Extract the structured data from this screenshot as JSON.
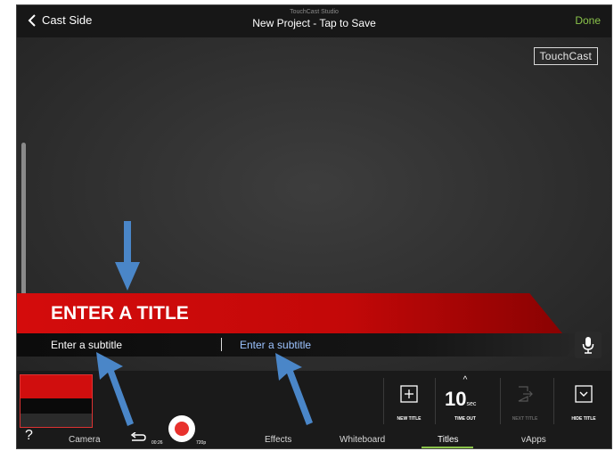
{
  "topbar": {
    "back_label": "Cast Side",
    "studio_label": "TouchCast Studio",
    "project_title": "New Project - Tap to Save",
    "done_label": "Done"
  },
  "stage": {
    "logo_text": "TouchCast",
    "title_text": "ENTER A TITLE",
    "subtitle_left": "Enter a subtitle",
    "subtitle_right": "Enter a subtitle"
  },
  "tools": {
    "new_title": "NEW TITLE",
    "timeout_value": "10",
    "timeout_unit": "sec",
    "timeout_label": "TIME OUT",
    "next_title": "NEXT TITLE",
    "hide_title": "HIDE TITLE"
  },
  "bottom_nav": {
    "help": "?",
    "camera": "Camera",
    "timer": "00:26",
    "resolution": "720p",
    "effects": "Effects",
    "whiteboard": "Whiteboard",
    "titles": "Titles",
    "vapps": "vApps",
    "active_tab": "Titles"
  },
  "colors": {
    "accent_green": "#8ac34a",
    "title_red": "#d40c0c",
    "annotation_blue": "#4a86c8",
    "subtitle_blue": "#9cc3ff"
  },
  "icons": [
    "chevron-left-icon",
    "microphone-icon",
    "plus-box-icon",
    "caret-up-icon",
    "next-title-icon",
    "chevron-down-box-icon",
    "undo-icon",
    "record-icon"
  ]
}
